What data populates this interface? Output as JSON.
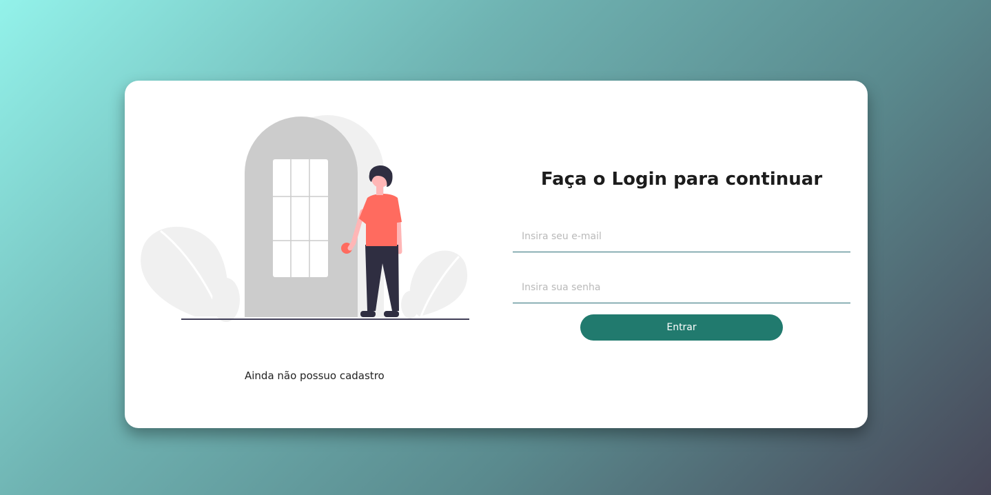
{
  "login": {
    "title": "Faça o Login para continuar",
    "email_placeholder": "Insira seu e-mail",
    "email_value": "",
    "password_placeholder": "Insira sua senha",
    "password_value": "",
    "submit_label": "Entrar"
  },
  "signup": {
    "link_label": "Ainda não possuo cadastro"
  },
  "illustration": {
    "icon": "person-at-door-illustration",
    "colors": {
      "door": "#cccccc",
      "leaf": "#f0f0f0",
      "shirt": "#ff6b5f",
      "pants": "#2f2e41",
      "skin": "#ffb6b6"
    }
  },
  "colors": {
    "accent": "#217a6e",
    "input_border": "#2b6f78"
  }
}
